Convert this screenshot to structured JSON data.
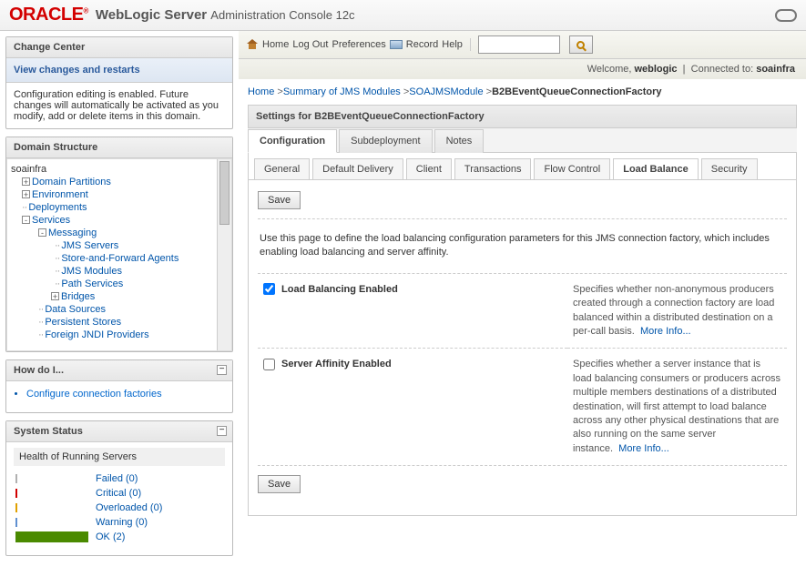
{
  "header": {
    "brand": "ORACLE",
    "product": "WebLogic Server",
    "subtitle": "Administration Console 12c"
  },
  "toolbar": {
    "home": "Home",
    "logout": "Log Out",
    "prefs": "Preferences",
    "record": "Record",
    "help": "Help",
    "search_placeholder": ""
  },
  "welcome": {
    "greeting": "Welcome,",
    "user": "weblogic",
    "connected": "Connected to:",
    "domain": "soainfra"
  },
  "change_center": {
    "title": "Change Center",
    "link": "View changes and restarts",
    "desc": "Configuration editing is enabled. Future changes will automatically be activated as you modify, add or delete items in this domain."
  },
  "domain_structure": {
    "title": "Domain Structure",
    "root": "soainfra",
    "items": [
      {
        "label": "Domain Partitions",
        "level": 1,
        "toggle": "+"
      },
      {
        "label": "Environment",
        "level": 1,
        "toggle": "+"
      },
      {
        "label": "Deployments",
        "level": 1,
        "dots": true
      },
      {
        "label": "Services",
        "level": 1,
        "toggle": "-"
      },
      {
        "label": "Messaging",
        "level": 2,
        "toggle": "-"
      },
      {
        "label": "JMS Servers",
        "level": 3,
        "dots": true
      },
      {
        "label": "Store-and-Forward Agents",
        "level": 3,
        "dots": true
      },
      {
        "label": "JMS Modules",
        "level": 3,
        "dots": true
      },
      {
        "label": "Path Services",
        "level": 3,
        "dots": true
      },
      {
        "label": "Bridges",
        "level": "3b",
        "toggle": "+"
      },
      {
        "label": "Data Sources",
        "level": 2,
        "dots": true
      },
      {
        "label": "Persistent Stores",
        "level": 2,
        "dots": true
      },
      {
        "label": "Foreign JNDI Providers",
        "level": 2,
        "dots": true
      }
    ]
  },
  "how_do_i": {
    "title": "How do I...",
    "item": "Configure connection factories"
  },
  "system_status": {
    "title": "System Status",
    "subtitle": "Health of Running Servers",
    "rows": [
      {
        "cls": "failed",
        "label": "Failed (0)"
      },
      {
        "cls": "critical",
        "label": "Critical (0)"
      },
      {
        "cls": "overloaded",
        "label": "Overloaded (0)"
      },
      {
        "cls": "warning",
        "label": "Warning (0)"
      },
      {
        "cls": "ok",
        "label": "OK (2)"
      }
    ]
  },
  "breadcrumb": {
    "home": "Home",
    "l1": "Summary of JMS Modules",
    "l2": "SOAJMSModule",
    "current": "B2BEventQueueConnectionFactory"
  },
  "settings": {
    "title": "Settings for B2BEventQueueConnectionFactory",
    "tabs": [
      "Configuration",
      "Subdeployment",
      "Notes"
    ],
    "tabs_active": 0,
    "subtabs": [
      "General",
      "Default Delivery",
      "Client",
      "Transactions",
      "Flow Control",
      "Load Balance",
      "Security"
    ],
    "subtabs_active": 5,
    "save": "Save",
    "intro": "Use this page to define the load balancing configuration parameters for this JMS connection factory, which includes enabling load balancing and server affinity.",
    "fields": [
      {
        "label": "Load Balancing Enabled",
        "checked": true,
        "desc": "Specifies whether non-anonymous producers created through a connection factory are load balanced within a distributed destination on a per-call basis.",
        "more": "More Info..."
      },
      {
        "label": "Server Affinity Enabled",
        "checked": false,
        "desc": "Specifies whether a server instance that is load balancing consumers or producers across multiple members destinations of a distributed destination, will first attempt to load balance across any other physical destinations that are also running on the same server instance.",
        "more": "More Info..."
      }
    ]
  }
}
